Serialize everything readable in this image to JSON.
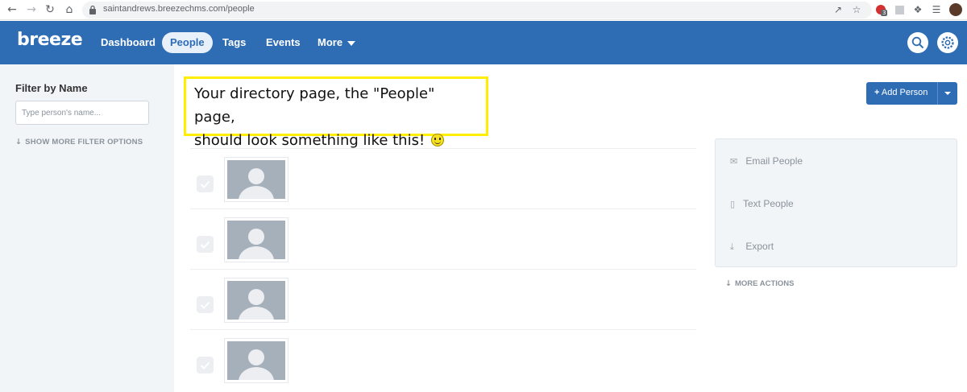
{
  "browser": {
    "url_domain": "saintandrews.breezechms.com",
    "url_path": "/people",
    "ext_badge": "3"
  },
  "header": {
    "logo": "breeze",
    "nav": [
      "Dashboard",
      "People",
      "Tags",
      "Events",
      "More"
    ],
    "active_nav": "People"
  },
  "sidebar": {
    "filter_title": "Filter by Name",
    "filter_placeholder": "Type person's name...",
    "more_filter": "SHOW MORE FILTER OPTIONS"
  },
  "callout": {
    "line1": "Your directory page, the \"People\" page,",
    "line2": "should look something like this!"
  },
  "actions": {
    "add_person": "Add Person",
    "items": [
      "Email People",
      "Text People",
      "Export"
    ],
    "more_actions": "MORE ACTIONS"
  },
  "colors": {
    "brand": "#2e6db4",
    "highlight": "#ffee00"
  }
}
